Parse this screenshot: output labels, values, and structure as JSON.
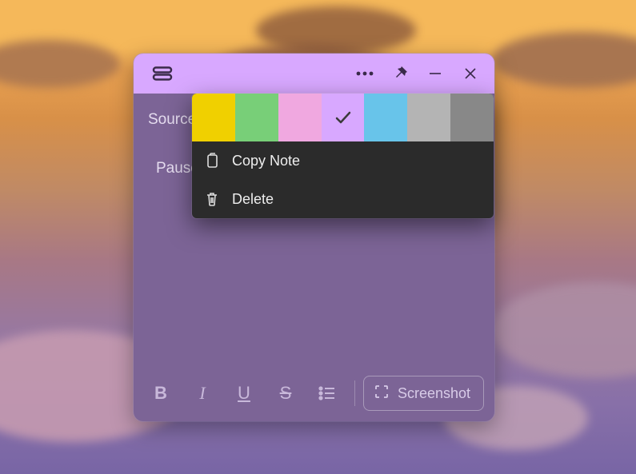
{
  "note": {
    "line1": "Source:",
    "line2": "Pause"
  },
  "menu": {
    "colors": [
      {
        "name": "yellow",
        "hex": "#f0d000",
        "selected": false
      },
      {
        "name": "green",
        "hex": "#78cf78",
        "selected": false
      },
      {
        "name": "pink",
        "hex": "#f0a8e0",
        "selected": false
      },
      {
        "name": "purple",
        "hex": "#d8a8ff",
        "selected": true
      },
      {
        "name": "blue",
        "hex": "#68c4ea",
        "selected": false
      },
      {
        "name": "gray",
        "hex": "#b4b4b4",
        "selected": false
      },
      {
        "name": "darkgray",
        "hex": "#888888",
        "selected": false
      }
    ],
    "copy_label": "Copy Note",
    "delete_label": "Delete"
  },
  "toolbar": {
    "screenshot_label": "Screenshot"
  }
}
